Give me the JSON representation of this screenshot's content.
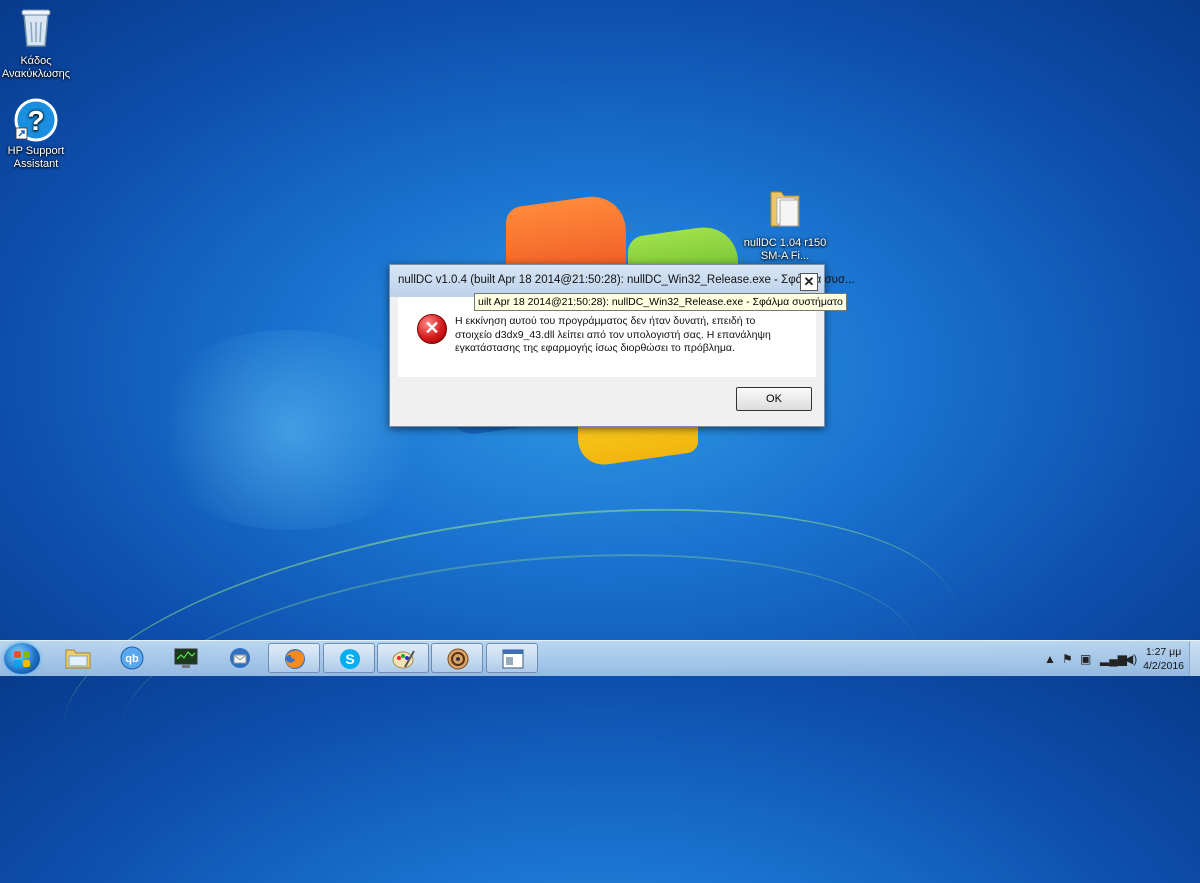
{
  "desktop": {
    "icons": [
      {
        "label": "Κάδος Ανακύκλωσης",
        "icon": "recycle-bin-icon"
      },
      {
        "label": "HP Support Assistant",
        "icon": "hp-support-icon"
      },
      {
        "label": "nullDC 1.04 r150 SM-A Fi...",
        "icon": "folder-icon"
      }
    ]
  },
  "dialog": {
    "title": "nullDC v1.0.4 (built Apr 18 2014@21:50:28): nullDC_Win32_Release.exe - Σφάλμα συσ...",
    "close_label": "✕",
    "message": "Η εκκίνηση αυτού του προγράμματος δεν ήταν δυνατή, επειδή το στοιχείο d3dx9_43.dll λείπει από τον υπολογιστή σας. Η επανάληψη εγκατάστασης της εφαρμογής ίσως διορθώσει το πρόβλημα.",
    "ok_label": "OK",
    "icon": "error-icon"
  },
  "tooltip": {
    "text": "uilt Apr 18 2014@21:50:28): nullDC_Win32_Release.exe - Σφάλμα συστήματο"
  },
  "taskbar": {
    "buttons": [
      {
        "name": "explorer",
        "icon": "folder-icon"
      },
      {
        "name": "qbittorrent",
        "icon": "qbittorrent-icon"
      },
      {
        "name": "system-monitor",
        "icon": "monitor-icon"
      },
      {
        "name": "thunderbird",
        "icon": "thunderbird-icon"
      },
      {
        "name": "firefox",
        "icon": "firefox-icon"
      },
      {
        "name": "skype",
        "icon": "skype-icon"
      },
      {
        "name": "paint",
        "icon": "paint-icon"
      },
      {
        "name": "media-app",
        "icon": "disc-icon"
      },
      {
        "name": "nulldc-window",
        "icon": "window-icon"
      }
    ],
    "clock": {
      "time": "1:27 μμ",
      "date": "4/2/2016"
    }
  }
}
